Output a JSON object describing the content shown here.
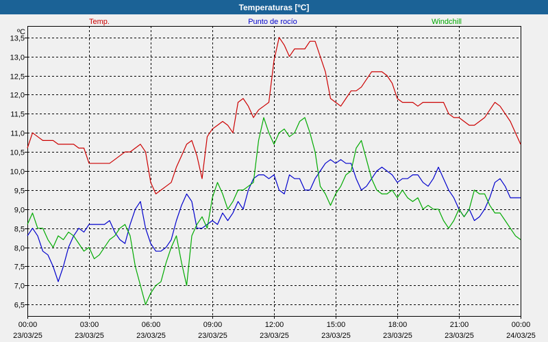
{
  "window": {
    "title": "Temperaturas [ºC]"
  },
  "chart_data": {
    "type": "line",
    "title": "Temperaturas [ºC]",
    "ylabel": "ºC",
    "ylim": [
      6.2,
      13.8
    ],
    "grid": true,
    "yticks": [
      "6,5",
      "7,0",
      "7,5",
      "8,0",
      "8,5",
      "9,0",
      "9,5",
      "10,0",
      "10,5",
      "11,0",
      "11,5",
      "12,0",
      "12,5",
      "13,0",
      "13,5"
    ],
    "ytick_values": [
      6.5,
      7.0,
      7.5,
      8.0,
      8.5,
      9.0,
      9.5,
      10.0,
      10.5,
      11.0,
      11.5,
      12.0,
      12.5,
      13.0,
      13.5
    ],
    "xticks": [
      {
        "time": "00:00",
        "date": "23/03/25"
      },
      {
        "time": "03:00",
        "date": "23/03/25"
      },
      {
        "time": "06:00",
        "date": "23/03/25"
      },
      {
        "time": "09:00",
        "date": "23/03/25"
      },
      {
        "time": "12:00",
        "date": "23/03/25"
      },
      {
        "time": "15:00",
        "date": "23/03/25"
      },
      {
        "time": "18:00",
        "date": "23/03/25"
      },
      {
        "time": "21:00",
        "date": "23/03/25"
      },
      {
        "time": "00:00",
        "date": "24/03/25"
      }
    ],
    "series": [
      {
        "name": "Temp.",
        "color": "#cc0000",
        "x": [
          0,
          0.25,
          0.5,
          0.75,
          1,
          1.25,
          1.5,
          1.75,
          2,
          2.25,
          2.5,
          2.75,
          3,
          3.25,
          3.5,
          3.75,
          4,
          4.25,
          4.5,
          4.75,
          5,
          5.25,
          5.5,
          5.75,
          6,
          6.25,
          6.5,
          6.75,
          7,
          7.25,
          7.5,
          7.75,
          8,
          8.25,
          8.5,
          8.75,
          9,
          9.25,
          9.5,
          9.75,
          10,
          10.25,
          10.5,
          10.75,
          11,
          11.25,
          11.5,
          11.75,
          12,
          12.25,
          12.5,
          12.75,
          13,
          13.25,
          13.5,
          13.75,
          14,
          14.25,
          14.5,
          14.75,
          15,
          15.25,
          15.5,
          15.75,
          16,
          16.25,
          16.5,
          16.75,
          17,
          17.25,
          17.5,
          17.75,
          18,
          18.25,
          18.5,
          18.75,
          19,
          19.25,
          19.5,
          19.75,
          20,
          20.25,
          20.5,
          20.75,
          21,
          21.25,
          21.5,
          21.75,
          22,
          22.25,
          22.5,
          22.75,
          23,
          23.25,
          23.5,
          23.75,
          24
        ],
        "values": [
          10.6,
          11.0,
          10.9,
          10.8,
          10.8,
          10.8,
          10.7,
          10.7,
          10.7,
          10.7,
          10.6,
          10.6,
          10.2,
          10.2,
          10.2,
          10.2,
          10.2,
          10.3,
          10.4,
          10.5,
          10.5,
          10.6,
          10.7,
          10.5,
          9.7,
          9.4,
          9.5,
          9.6,
          9.7,
          10.1,
          10.4,
          10.7,
          10.8,
          10.4,
          9.8,
          10.9,
          11.1,
          11.2,
          11.3,
          11.2,
          11.0,
          11.8,
          11.9,
          11.7,
          11.4,
          11.6,
          11.7,
          11.8,
          12.9,
          13.5,
          13.3,
          13.0,
          13.2,
          13.2,
          13.2,
          13.4,
          13.4,
          13.0,
          12.6,
          11.9,
          11.8,
          11.7,
          11.9,
          12.1,
          12.1,
          12.2,
          12.4,
          12.6,
          12.6,
          12.6,
          12.5,
          12.3,
          11.9,
          11.8,
          11.8,
          11.8,
          11.7,
          11.8,
          11.8,
          11.8,
          11.8,
          11.8,
          11.5,
          11.4,
          11.4,
          11.3,
          11.2,
          11.2,
          11.3,
          11.4,
          11.6,
          11.8,
          11.7,
          11.5,
          11.3,
          11.0,
          10.7
        ]
      },
      {
        "name": "Punto de rocío",
        "color": "#0000cc",
        "x": [
          0,
          0.25,
          0.5,
          0.75,
          1,
          1.25,
          1.5,
          1.75,
          2,
          2.25,
          2.5,
          2.75,
          3,
          3.25,
          3.5,
          3.75,
          4,
          4.25,
          4.5,
          4.75,
          5,
          5.25,
          5.5,
          5.75,
          6,
          6.25,
          6.5,
          6.75,
          7,
          7.25,
          7.5,
          7.75,
          8,
          8.25,
          8.5,
          8.75,
          9,
          9.25,
          9.5,
          9.75,
          10,
          10.25,
          10.5,
          10.75,
          11,
          11.25,
          11.5,
          11.75,
          12,
          12.25,
          12.5,
          12.75,
          13,
          13.25,
          13.5,
          13.75,
          14,
          14.25,
          14.5,
          14.75,
          15,
          15.25,
          15.5,
          15.75,
          16,
          16.25,
          16.5,
          16.75,
          17,
          17.25,
          17.5,
          17.75,
          18,
          18.25,
          18.5,
          18.75,
          19,
          19.25,
          19.5,
          19.75,
          20,
          20.25,
          20.5,
          20.75,
          21,
          21.25,
          21.5,
          21.75,
          22,
          22.25,
          22.5,
          22.75,
          23,
          23.25,
          23.5,
          23.75,
          24
        ],
        "values": [
          8.3,
          8.5,
          8.3,
          7.9,
          7.8,
          7.5,
          7.1,
          7.5,
          8.0,
          8.3,
          8.5,
          8.4,
          8.6,
          8.6,
          8.6,
          8.6,
          8.7,
          8.4,
          8.2,
          8.1,
          8.6,
          9.0,
          9.2,
          8.5,
          8.1,
          7.9,
          7.9,
          8.0,
          8.2,
          8.7,
          9.1,
          9.4,
          9.2,
          8.5,
          8.5,
          8.6,
          8.7,
          8.6,
          8.9,
          8.7,
          8.9,
          9.2,
          9.0,
          9.5,
          9.8,
          9.9,
          9.9,
          9.8,
          9.9,
          9.5,
          9.4,
          9.9,
          9.8,
          9.8,
          9.5,
          9.5,
          9.8,
          10.0,
          10.2,
          10.3,
          10.2,
          10.3,
          10.2,
          10.2,
          9.8,
          9.5,
          9.6,
          9.8,
          10.0,
          10.1,
          10.0,
          9.9,
          9.7,
          9.8,
          9.8,
          9.9,
          9.9,
          9.7,
          9.6,
          9.8,
          10.1,
          9.8,
          9.5,
          9.3,
          9.0,
          8.8,
          9.0,
          8.7,
          8.8,
          9.0,
          9.3,
          9.7,
          9.8,
          9.6,
          9.3,
          9.3,
          9.3
        ]
      },
      {
        "name": "Windchill",
        "color": "#00aa00",
        "x": [
          0,
          0.25,
          0.5,
          0.75,
          1,
          1.25,
          1.5,
          1.75,
          2,
          2.25,
          2.5,
          2.75,
          3,
          3.25,
          3.5,
          3.75,
          4,
          4.25,
          4.5,
          4.75,
          5,
          5.25,
          5.5,
          5.75,
          6,
          6.25,
          6.5,
          6.75,
          7,
          7.25,
          7.5,
          7.75,
          8,
          8.25,
          8.5,
          8.75,
          9,
          9.25,
          9.5,
          9.75,
          10,
          10.25,
          10.5,
          10.75,
          11,
          11.25,
          11.5,
          11.75,
          12,
          12.25,
          12.5,
          12.75,
          13,
          13.25,
          13.5,
          13.75,
          14,
          14.25,
          14.5,
          14.75,
          15,
          15.25,
          15.5,
          15.75,
          16,
          16.25,
          16.5,
          16.75,
          17,
          17.25,
          17.5,
          17.75,
          18,
          18.25,
          18.5,
          18.75,
          19,
          19.25,
          19.5,
          19.75,
          20,
          20.25,
          20.5,
          20.75,
          21,
          21.25,
          21.5,
          21.75,
          22,
          22.25,
          22.5,
          22.75,
          23,
          23.25,
          23.5,
          23.75,
          24
        ],
        "values": [
          8.6,
          8.9,
          8.5,
          8.5,
          8.2,
          8.0,
          8.3,
          8.2,
          8.4,
          8.3,
          8.1,
          7.9,
          8.0,
          7.7,
          7.8,
          8.0,
          8.2,
          8.3,
          8.5,
          8.6,
          8.3,
          7.5,
          7.0,
          6.5,
          6.8,
          7.0,
          7.1,
          7.6,
          8.0,
          8.3,
          7.6,
          7.0,
          8.3,
          8.6,
          8.8,
          8.5,
          9.3,
          9.7,
          9.4,
          9.0,
          9.2,
          9.5,
          9.5,
          9.6,
          9.7,
          10.8,
          11.4,
          11.0,
          10.7,
          11.0,
          11.1,
          10.9,
          11.0,
          11.3,
          11.4,
          11.0,
          10.5,
          9.6,
          9.4,
          9.1,
          9.4,
          9.6,
          9.9,
          10.0,
          10.6,
          10.8,
          10.3,
          9.8,
          9.5,
          9.4,
          9.4,
          9.5,
          9.3,
          9.5,
          9.3,
          9.2,
          9.3,
          9.0,
          9.1,
          9.0,
          9.0,
          8.7,
          8.5,
          8.7,
          9.0,
          8.8,
          9.0,
          9.5,
          9.4,
          9.4,
          9.1,
          8.9,
          8.9,
          8.7,
          8.5,
          8.3,
          8.2
        ]
      }
    ]
  }
}
